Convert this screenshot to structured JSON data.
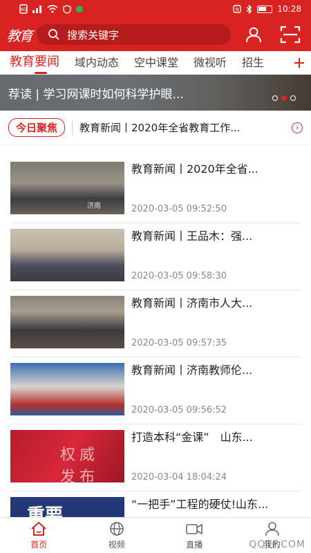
{
  "status_bar": {
    "time": "10:28"
  },
  "header": {
    "logo_text": "教育",
    "search_placeholder": "搜索关键字"
  },
  "tabs": [
    {
      "label": "教育要闻",
      "active": true
    },
    {
      "label": "域内动态"
    },
    {
      "label": "空中课堂"
    },
    {
      "label": "微视听"
    },
    {
      "label": "招生"
    }
  ],
  "banner": {
    "caption": "荐读 | 学习网课时如何科学护眼..."
  },
  "focus": {
    "tag": "今日聚焦",
    "text": "教育新闻丨2020年全省教育工作..."
  },
  "news": [
    {
      "title": "教育新闻丨2020年全省...",
      "time": "2020-03-05 09:52:50",
      "thumb_text": "济南"
    },
    {
      "title": "教育新闻丨王品木：强...",
      "time": "2020-03-05 09:58:30",
      "thumb_text": ""
    },
    {
      "title": "教育新闻丨济南市人大...",
      "time": "2020-03-05 09:57:35",
      "thumb_text": ""
    },
    {
      "title": "教育新闻丨济南教师伦...",
      "time": "2020-03-05 09:56:52",
      "thumb_text": ""
    },
    {
      "title": "打造本科“金课”　山东...",
      "time": "2020-03-04 18:04:24",
      "thumb_text": "权威 发布"
    },
    {
      "title": "“一把手”工程的硬仗!山东...",
      "time": "",
      "thumb_text": "重要"
    }
  ],
  "bottom_nav": [
    {
      "label": "首页",
      "active": true,
      "icon": "home-icon"
    },
    {
      "label": "视频",
      "icon": "video-globe-icon"
    },
    {
      "label": "直播",
      "icon": "live-camera-icon"
    },
    {
      "label": "我的",
      "icon": "user-icon"
    }
  ],
  "watermark": "QQTF.COM",
  "colors": {
    "brand_red": "#d92322",
    "search_bg": "#b71c1c"
  }
}
